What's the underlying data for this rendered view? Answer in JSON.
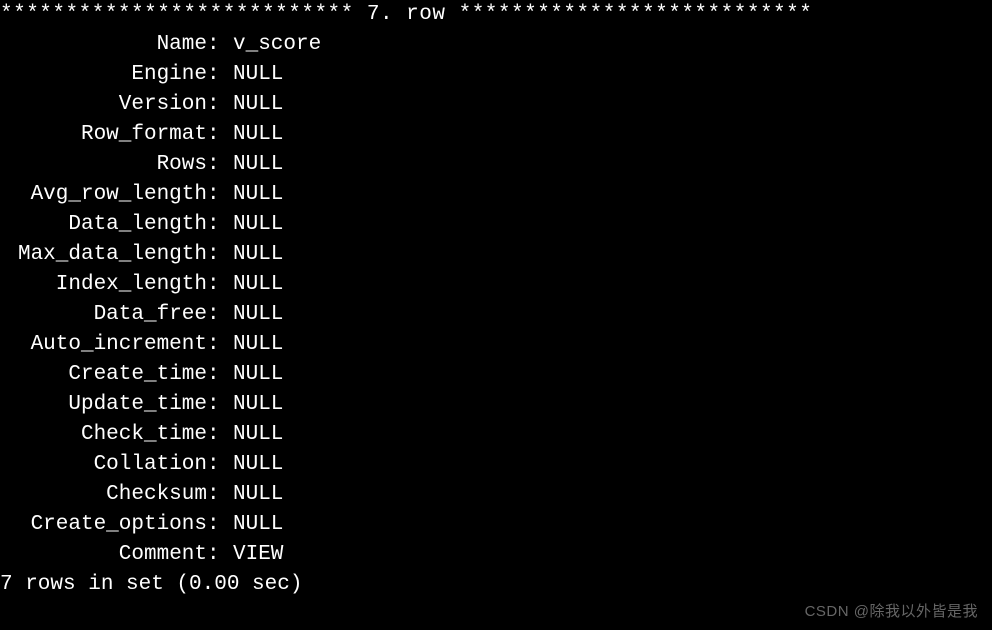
{
  "header": {
    "stars_left": "***************************",
    "row_label": " 7. row ",
    "stars_right": "***************************"
  },
  "fields": [
    {
      "label": "Name",
      "value": "v_score"
    },
    {
      "label": "Engine",
      "value": "NULL"
    },
    {
      "label": "Version",
      "value": "NULL"
    },
    {
      "label": "Row_format",
      "value": "NULL"
    },
    {
      "label": "Rows",
      "value": "NULL"
    },
    {
      "label": "Avg_row_length",
      "value": "NULL"
    },
    {
      "label": "Data_length",
      "value": "NULL"
    },
    {
      "label": "Max_data_length",
      "value": "NULL"
    },
    {
      "label": "Index_length",
      "value": "NULL"
    },
    {
      "label": "Data_free",
      "value": "NULL"
    },
    {
      "label": "Auto_increment",
      "value": "NULL"
    },
    {
      "label": "Create_time",
      "value": "NULL"
    },
    {
      "label": "Update_time",
      "value": "NULL"
    },
    {
      "label": "Check_time",
      "value": "NULL"
    },
    {
      "label": "Collation",
      "value": "NULL"
    },
    {
      "label": "Checksum",
      "value": "NULL"
    },
    {
      "label": "Create_options",
      "value": "NULL"
    },
    {
      "label": "Comment",
      "value": "VIEW"
    }
  ],
  "footer": {
    "text": "7 rows in set (0.00 sec)"
  },
  "watermark": {
    "text": "CSDN @除我以外皆是我"
  }
}
